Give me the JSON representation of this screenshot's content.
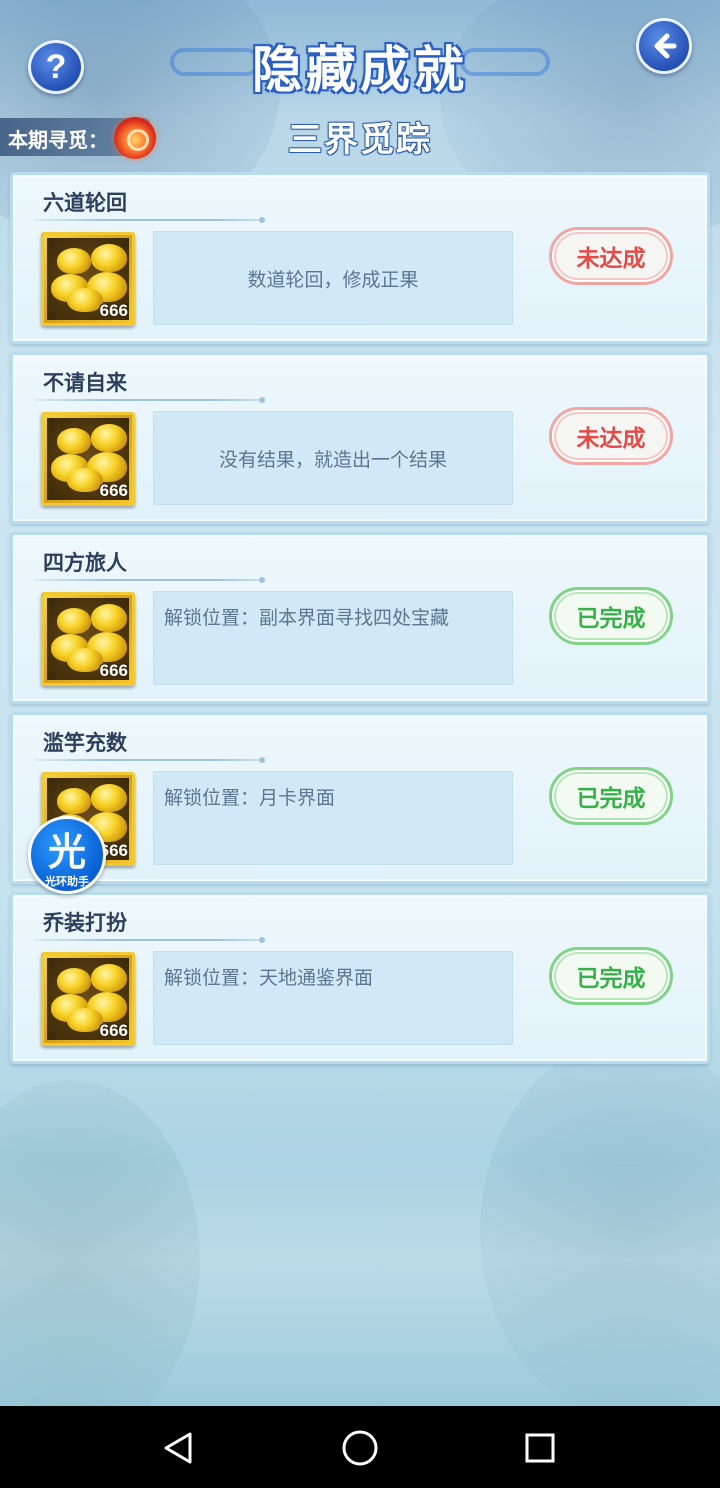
{
  "header": {
    "title": "隐藏成就",
    "help_icon": "question-icon",
    "back_icon": "back-arrow-icon"
  },
  "period": {
    "label": "本期寻觅：",
    "icon": "fire-orb-icon",
    "name": "三界觅踪"
  },
  "achievements": [
    {
      "title": "六道轮回",
      "reward_count": "666",
      "description": "数道轮回，修成正果",
      "status": "未达成",
      "status_type": "incomplete"
    },
    {
      "title": "不请自来",
      "reward_count": "666",
      "description": "没有结果，就造出一个结果",
      "status": "未达成",
      "status_type": "incomplete"
    },
    {
      "title": "四方旅人",
      "reward_count": "666",
      "description": "解锁位置：副本界面寻找四处宝藏",
      "status": "已完成",
      "status_type": "complete"
    },
    {
      "title": "滥竽充数",
      "reward_count": "666",
      "description": "解锁位置：月卡界面",
      "status": "已完成",
      "status_type": "complete"
    },
    {
      "title": "乔装打扮",
      "reward_count": "666",
      "description": "解锁位置：天地通鉴界面",
      "status": "已完成",
      "status_type": "complete"
    }
  ],
  "assistant": {
    "glyph": "光",
    "label": "光环助手"
  },
  "colors": {
    "incomplete": "#e44b47",
    "complete": "#36b14a",
    "title_outline": "#2a5bb8"
  },
  "navbar": {
    "back": "triangle-back-icon",
    "home": "circle-home-icon",
    "recents": "square-recents-icon"
  }
}
